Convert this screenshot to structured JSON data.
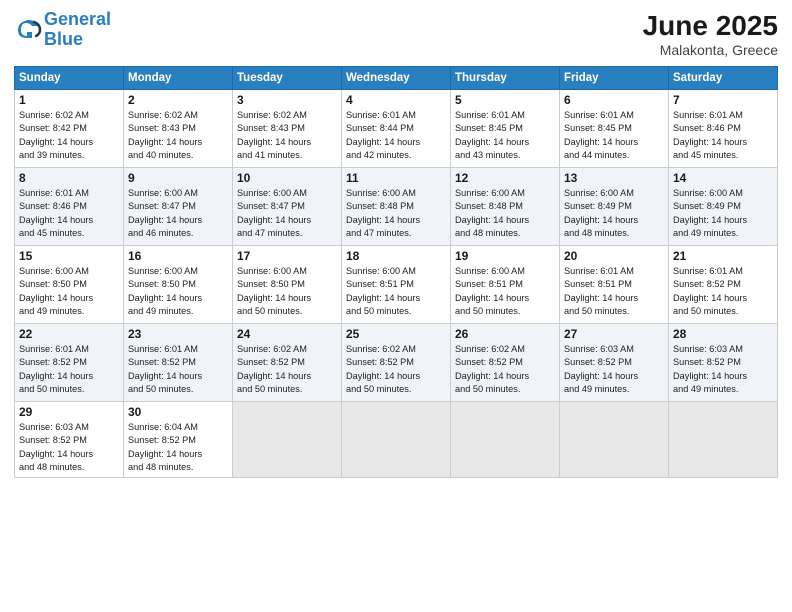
{
  "logo": {
    "line1": "General",
    "line2": "Blue"
  },
  "title": "June 2025",
  "subtitle": "Malakonta, Greece",
  "days_header": [
    "Sunday",
    "Monday",
    "Tuesday",
    "Wednesday",
    "Thursday",
    "Friday",
    "Saturday"
  ],
  "weeks": [
    [
      {
        "day": "1",
        "info": "Sunrise: 6:02 AM\nSunset: 8:42 PM\nDaylight: 14 hours\nand 39 minutes."
      },
      {
        "day": "2",
        "info": "Sunrise: 6:02 AM\nSunset: 8:43 PM\nDaylight: 14 hours\nand 40 minutes."
      },
      {
        "day": "3",
        "info": "Sunrise: 6:02 AM\nSunset: 8:43 PM\nDaylight: 14 hours\nand 41 minutes."
      },
      {
        "day": "4",
        "info": "Sunrise: 6:01 AM\nSunset: 8:44 PM\nDaylight: 14 hours\nand 42 minutes."
      },
      {
        "day": "5",
        "info": "Sunrise: 6:01 AM\nSunset: 8:45 PM\nDaylight: 14 hours\nand 43 minutes."
      },
      {
        "day": "6",
        "info": "Sunrise: 6:01 AM\nSunset: 8:45 PM\nDaylight: 14 hours\nand 44 minutes."
      },
      {
        "day": "7",
        "info": "Sunrise: 6:01 AM\nSunset: 8:46 PM\nDaylight: 14 hours\nand 45 minutes."
      }
    ],
    [
      {
        "day": "8",
        "info": "Sunrise: 6:01 AM\nSunset: 8:46 PM\nDaylight: 14 hours\nand 45 minutes."
      },
      {
        "day": "9",
        "info": "Sunrise: 6:00 AM\nSunset: 8:47 PM\nDaylight: 14 hours\nand 46 minutes."
      },
      {
        "day": "10",
        "info": "Sunrise: 6:00 AM\nSunset: 8:47 PM\nDaylight: 14 hours\nand 47 minutes."
      },
      {
        "day": "11",
        "info": "Sunrise: 6:00 AM\nSunset: 8:48 PM\nDaylight: 14 hours\nand 47 minutes."
      },
      {
        "day": "12",
        "info": "Sunrise: 6:00 AM\nSunset: 8:48 PM\nDaylight: 14 hours\nand 48 minutes."
      },
      {
        "day": "13",
        "info": "Sunrise: 6:00 AM\nSunset: 8:49 PM\nDaylight: 14 hours\nand 48 minutes."
      },
      {
        "day": "14",
        "info": "Sunrise: 6:00 AM\nSunset: 8:49 PM\nDaylight: 14 hours\nand 49 minutes."
      }
    ],
    [
      {
        "day": "15",
        "info": "Sunrise: 6:00 AM\nSunset: 8:50 PM\nDaylight: 14 hours\nand 49 minutes."
      },
      {
        "day": "16",
        "info": "Sunrise: 6:00 AM\nSunset: 8:50 PM\nDaylight: 14 hours\nand 49 minutes."
      },
      {
        "day": "17",
        "info": "Sunrise: 6:00 AM\nSunset: 8:50 PM\nDaylight: 14 hours\nand 50 minutes."
      },
      {
        "day": "18",
        "info": "Sunrise: 6:00 AM\nSunset: 8:51 PM\nDaylight: 14 hours\nand 50 minutes."
      },
      {
        "day": "19",
        "info": "Sunrise: 6:00 AM\nSunset: 8:51 PM\nDaylight: 14 hours\nand 50 minutes."
      },
      {
        "day": "20",
        "info": "Sunrise: 6:01 AM\nSunset: 8:51 PM\nDaylight: 14 hours\nand 50 minutes."
      },
      {
        "day": "21",
        "info": "Sunrise: 6:01 AM\nSunset: 8:52 PM\nDaylight: 14 hours\nand 50 minutes."
      }
    ],
    [
      {
        "day": "22",
        "info": "Sunrise: 6:01 AM\nSunset: 8:52 PM\nDaylight: 14 hours\nand 50 minutes."
      },
      {
        "day": "23",
        "info": "Sunrise: 6:01 AM\nSunset: 8:52 PM\nDaylight: 14 hours\nand 50 minutes."
      },
      {
        "day": "24",
        "info": "Sunrise: 6:02 AM\nSunset: 8:52 PM\nDaylight: 14 hours\nand 50 minutes."
      },
      {
        "day": "25",
        "info": "Sunrise: 6:02 AM\nSunset: 8:52 PM\nDaylight: 14 hours\nand 50 minutes."
      },
      {
        "day": "26",
        "info": "Sunrise: 6:02 AM\nSunset: 8:52 PM\nDaylight: 14 hours\nand 50 minutes."
      },
      {
        "day": "27",
        "info": "Sunrise: 6:03 AM\nSunset: 8:52 PM\nDaylight: 14 hours\nand 49 minutes."
      },
      {
        "day": "28",
        "info": "Sunrise: 6:03 AM\nSunset: 8:52 PM\nDaylight: 14 hours\nand 49 minutes."
      }
    ],
    [
      {
        "day": "29",
        "info": "Sunrise: 6:03 AM\nSunset: 8:52 PM\nDaylight: 14 hours\nand 48 minutes."
      },
      {
        "day": "30",
        "info": "Sunrise: 6:04 AM\nSunset: 8:52 PM\nDaylight: 14 hours\nand 48 minutes."
      },
      null,
      null,
      null,
      null,
      null
    ]
  ]
}
